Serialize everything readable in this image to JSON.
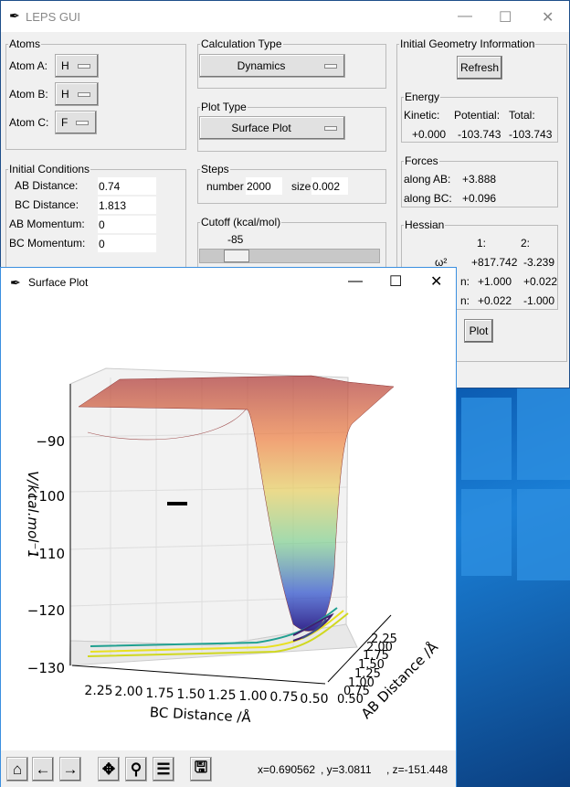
{
  "main_window": {
    "title": "LEPS GUI",
    "icon": "feather-icon"
  },
  "atoms": {
    "title": "Atoms",
    "rows": [
      {
        "label": "Atom A:",
        "value": "H"
      },
      {
        "label": "Atom B:",
        "value": "H"
      },
      {
        "label": "Atom C:",
        "value": "F"
      }
    ]
  },
  "calc": {
    "title": "Calculation Type",
    "value": "Dynamics"
  },
  "plot_type": {
    "title": "Plot Type",
    "value": "Surface Plot"
  },
  "initial": {
    "title": "Initial Conditions",
    "rows": [
      {
        "label": "AB Distance:",
        "value": "0.74"
      },
      {
        "label": "BC Distance:",
        "value": "1.813"
      },
      {
        "label": "AB Momentum:",
        "value": "0"
      },
      {
        "label": "BC Momentum:",
        "value": "0"
      }
    ]
  },
  "steps": {
    "title": "Steps",
    "number_label": "number",
    "number": "2000",
    "size_label": "size",
    "size": "0.002"
  },
  "cutoff": {
    "title": "Cutoff (kcal/mol)",
    "value": "-85",
    "slider_fraction": 0.1
  },
  "geometry": {
    "title": "Initial Geometry Information",
    "refresh": "Refresh",
    "energy": {
      "title": "Energy",
      "headers": [
        "Kinetic:",
        "Potential:",
        "Total:"
      ],
      "values": [
        "+0.000",
        "-103.743",
        "-103.743"
      ]
    },
    "forces": {
      "title": "Forces",
      "rows": [
        {
          "label": "along AB:",
          "value": "+3.888"
        },
        {
          "label": "along BC:",
          "value": "+0.096"
        }
      ]
    },
    "hessian": {
      "title": "Hessian",
      "cols": [
        "1:",
        "2:"
      ],
      "rows": [
        {
          "label": "ω²",
          "v1": "+817.742",
          "v2": "-3.239"
        },
        {
          "label": "n:",
          "v1": "+1.000",
          "v2": "+0.022"
        },
        {
          "label": "n:",
          "v1": "+0.022",
          "v2": "-1.000"
        }
      ]
    },
    "plot_button": "Plot"
  },
  "plot_window": {
    "title": "Surface Plot",
    "icon": "feather-icon",
    "status": {
      "x": "x=0.690562",
      "y": ", y=3.0811",
      "z": ", z=-151.448"
    }
  },
  "chart_data": {
    "type": "surface",
    "zlabel": "V/kcal.mol⁻1",
    "xlabel": "BC Distance /Å",
    "ylabel": "AB Distance /Å",
    "zticks": [
      "−90",
      "−100",
      "−110",
      "−120",
      "−130"
    ],
    "xticks": [
      "2.25",
      "2.00",
      "1.75",
      "1.50",
      "1.25",
      "1.00",
      "0.75",
      "0.50"
    ],
    "yticks": [
      "0.50",
      "0.75",
      "1.00",
      "1.25",
      "1.50",
      "1.75",
      "2.00",
      "2.25"
    ],
    "colormap": "viridis contour + jet surface"
  }
}
